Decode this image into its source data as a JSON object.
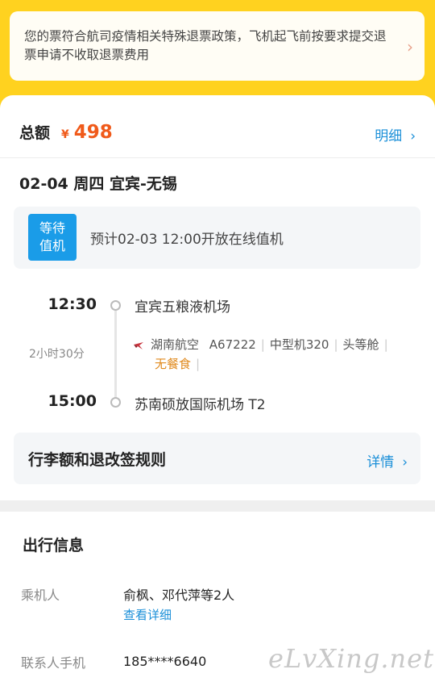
{
  "notice": {
    "text": "您的票符合航司疫情相关特殊退票政策，飞机起飞前按要求提交退票申请不收取退票费用",
    "chevron": "›"
  },
  "total": {
    "label": "总额",
    "currency": "¥",
    "amount": "498",
    "detail_label": "明细",
    "chevron": "›"
  },
  "route": {
    "title": "02-04 周四 宜宾-无锡"
  },
  "checkin": {
    "badge_line1": "等待",
    "badge_line2": "值机",
    "text": "预计02-03 12:00开放在线值机"
  },
  "flight": {
    "depart_time": "12:30",
    "depart_airport": "宜宾五粮液机场",
    "duration": "2小时30分",
    "airline": "湖南航空",
    "flight_no": "A67222",
    "aircraft": "中型机320",
    "cabin": "头等舱",
    "meal": "无餐食",
    "arrive_time": "15:00",
    "arrive_airport": "苏南硕放国际机场 T2",
    "separator": "|"
  },
  "rules": {
    "title": "行李额和退改签规则",
    "link": "详情",
    "chevron": "›"
  },
  "travel_info": {
    "title": "出行信息",
    "passenger_label": "乘机人",
    "passenger_value": "俞枫、邓代萍等2人",
    "passenger_link": "查看详细",
    "contact_label": "联系人手机",
    "contact_value": "185****6640"
  },
  "watermark": "eLvXing.net",
  "colors": {
    "accent_yellow": "#ffd21f",
    "price_orange": "#f05a1a",
    "link_blue": "#1a8fd8",
    "badge_blue": "#1a9ce8",
    "meal_orange": "#e08a1e"
  }
}
